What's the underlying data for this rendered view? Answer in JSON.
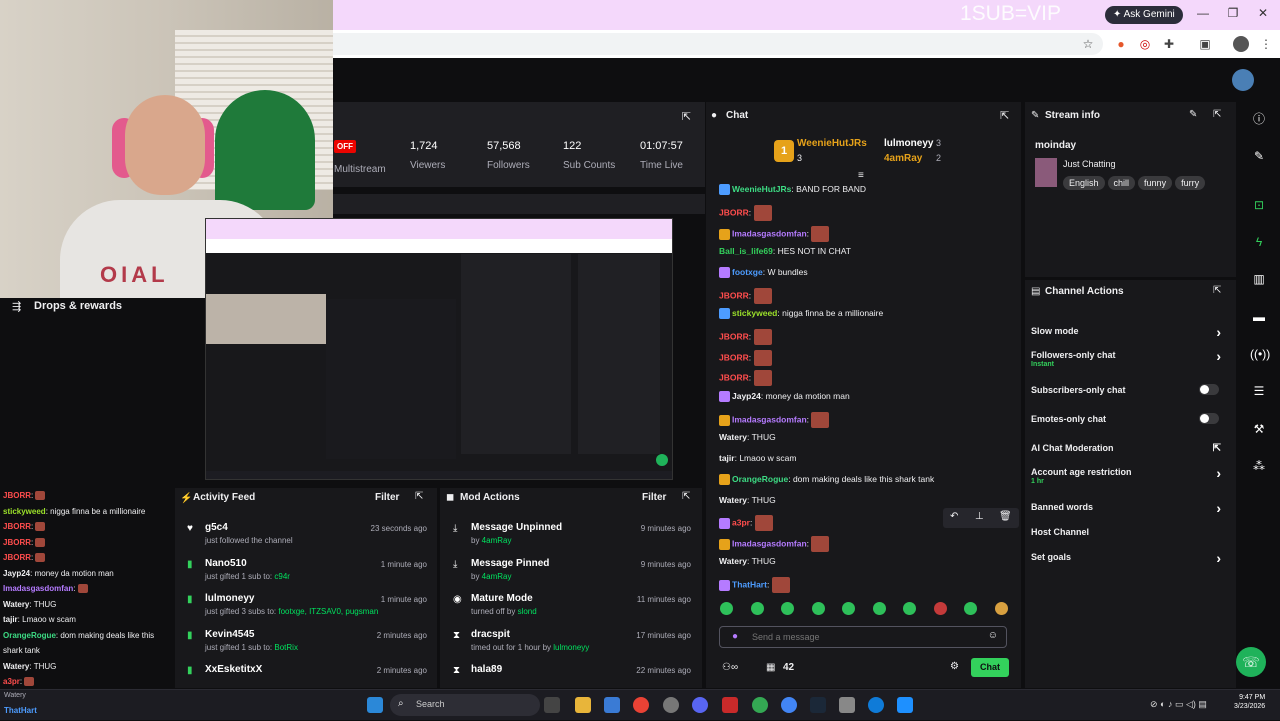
{
  "browser": {
    "watermark": "1SUB=VIP",
    "gemini_label": "Ask Gemini"
  },
  "webcam": {
    "shirt_text": "OIAL"
  },
  "drops": {
    "label": "Drops & rewards"
  },
  "stats": {
    "offline_badge": "OFF",
    "items": [
      {
        "value": "",
        "label": "Multistream"
      },
      {
        "value": "1,724",
        "label": "Viewers"
      },
      {
        "value": "57,568",
        "label": "Followers"
      },
      {
        "value": "122",
        "label": "Sub Counts"
      },
      {
        "value": "01:07:57",
        "label": "Time Live"
      }
    ]
  },
  "activity": {
    "title": "Activity Feed",
    "filter": "Filter",
    "items": [
      {
        "name": "g5c4",
        "desc": "just followed the channel",
        "time": "23 seconds ago"
      },
      {
        "name": "Nano510",
        "desc": "just gifted 1 sub to: ",
        "highlight": "c94r",
        "time": "1 minute ago"
      },
      {
        "name": "lulmoneyy",
        "desc": "just gifted 3 subs to: ",
        "highlight": "footxge, ITZSAV0, pugsman",
        "time": "1 minute ago"
      },
      {
        "name": "Kevin4545",
        "desc": "just gifted 1 sub to: ",
        "highlight": "BotRix",
        "time": "2 minutes ago"
      },
      {
        "name": "XxEsketitxX",
        "desc": "",
        "time": "2 minutes ago"
      }
    ]
  },
  "mod": {
    "title": "Mod Actions",
    "filter": "Filter",
    "items": [
      {
        "name": "Message Unpinned",
        "desc": "by ",
        "highlight": "4amRay",
        "time": "9 minutes ago"
      },
      {
        "name": "Message Pinned",
        "desc": "by ",
        "highlight": "4amRay",
        "time": "9 minutes ago"
      },
      {
        "name": "Mature Mode",
        "desc": "turned off by ",
        "highlight": "slond",
        "time": "11 minutes ago"
      },
      {
        "name": "dracspit",
        "desc": "timed out for 1 hour by ",
        "highlight": "lulmoneyy",
        "time": "17 minutes ago"
      },
      {
        "name": "hala89",
        "desc": "",
        "time": "22 minutes ago"
      }
    ]
  },
  "chat": {
    "title": "Chat",
    "leaderboard": [
      {
        "rank": "1",
        "name": "WeenieHutJRs",
        "count": "3"
      },
      {
        "rank": "",
        "name": "lulmoneyy",
        "count": "3"
      },
      {
        "rank": "",
        "name": "4amRay",
        "count": "2"
      }
    ],
    "messages": [
      {
        "user": "WeenieHutJRs",
        "color": "#3ddc84",
        "text": "BAND FOR BAND"
      },
      {
        "user": "JBORR",
        "color": "#ff4d4d",
        "text": ""
      },
      {
        "user": "Imadasgasdomfan",
        "color": "#b57bff",
        "text": ""
      },
      {
        "user": "Ball_is_life69",
        "color": "#33d15c",
        "text": "HES NOT IN CHAT"
      },
      {
        "user": "footxge",
        "color": "#4d9cff",
        "text": "W bundles"
      },
      {
        "user": "JBORR",
        "color": "#ff4d4d",
        "text": ""
      },
      {
        "user": "stickyweed",
        "color": "#9be02a",
        "text": "nigga finna be a millionaire"
      },
      {
        "user": "JBORR",
        "color": "#ff4d4d",
        "text": ""
      },
      {
        "user": "JBORR",
        "color": "#ff4d4d",
        "text": ""
      },
      {
        "user": "JBORR",
        "color": "#ff4d4d",
        "text": ""
      },
      {
        "user": "Jayp24",
        "color": "#efeff1",
        "text": "money da motion man"
      },
      {
        "user": "Imadasgasdomfan",
        "color": "#b57bff",
        "text": ""
      },
      {
        "user": "Watery",
        "color": "#efeff1",
        "text": "THUG"
      },
      {
        "user": "tajir",
        "color": "#efeff1",
        "text": "Lmaoo w scam"
      },
      {
        "user": "OrangeRogue",
        "color": "#3ddc84",
        "text": "dom making deals like this shark tank"
      },
      {
        "user": "Watery",
        "color": "#efeff1",
        "text": "THUG"
      },
      {
        "user": "a3pr",
        "color": "#ff4d4d",
        "text": ""
      },
      {
        "user": "Imadasgasdomfan",
        "color": "#b57bff",
        "text": ""
      },
      {
        "user": "Watery",
        "color": "#efeff1",
        "text": "THUG"
      },
      {
        "user": "ThatHart",
        "color": "#4d9cff",
        "text": ""
      }
    ],
    "placeholder": "Send a message",
    "viewer_count": "42",
    "send_label": "Chat"
  },
  "left_chat": [
    {
      "user": "JBORR",
      "text": ""
    },
    {
      "user": "stickyweed",
      "text": "nigga finna be a millionaire"
    },
    {
      "user": "JBORR",
      "text": ""
    },
    {
      "user": "JBORR",
      "text": ""
    },
    {
      "user": "JBORR",
      "text": ""
    },
    {
      "user": "Jayp24",
      "text": "money da motion man"
    },
    {
      "user": "Imadasgasdomfan",
      "text": ""
    },
    {
      "user": "Watery",
      "text": "THUG"
    },
    {
      "user": "tajir",
      "text": "Lmaoo w scam"
    },
    {
      "user": "OrangeRogue",
      "text": "dom making deals like this shark tank"
    },
    {
      "user": "Watery",
      "text": "THUG"
    },
    {
      "user": "a3pr",
      "text": ""
    },
    {
      "user": "Imadasgasdomfan",
      "text": ""
    },
    {
      "user": "Watery",
      "text": "THUG"
    },
    {
      "user": "ThatHart",
      "text": ""
    }
  ],
  "stream_info": {
    "title": "Stream info",
    "stream_title": "moinday",
    "category": "Just Chatting",
    "tags": [
      "English",
      "chill",
      "funny",
      "furry"
    ]
  },
  "channel_actions": {
    "title": "Channel Actions",
    "items": [
      {
        "label": "Slow mode",
        "type": "chevron",
        "sub": ""
      },
      {
        "label": "Followers-only chat",
        "type": "chevron",
        "sub": "Instant"
      },
      {
        "label": "Subscribers-only chat",
        "type": "toggle",
        "sub": ""
      },
      {
        "label": "Emotes-only chat",
        "type": "toggle",
        "sub": ""
      },
      {
        "label": "AI Chat Moderation",
        "type": "link",
        "sub": ""
      },
      {
        "label": "Account age restriction",
        "type": "chevron",
        "sub": "1 hr"
      },
      {
        "label": "Banned words",
        "type": "chevron",
        "sub": ""
      },
      {
        "label": "Host Channel",
        "type": "none",
        "sub": ""
      },
      {
        "label": "Set goals",
        "type": "chevron",
        "sub": ""
      }
    ]
  },
  "taskbar": {
    "search": "Search",
    "time": "9:47 PM",
    "date": "3/23/2026"
  },
  "colors": {
    "accent": "#33d15c",
    "badge_red": "#eb0400",
    "panel_bg": "#18181b"
  }
}
